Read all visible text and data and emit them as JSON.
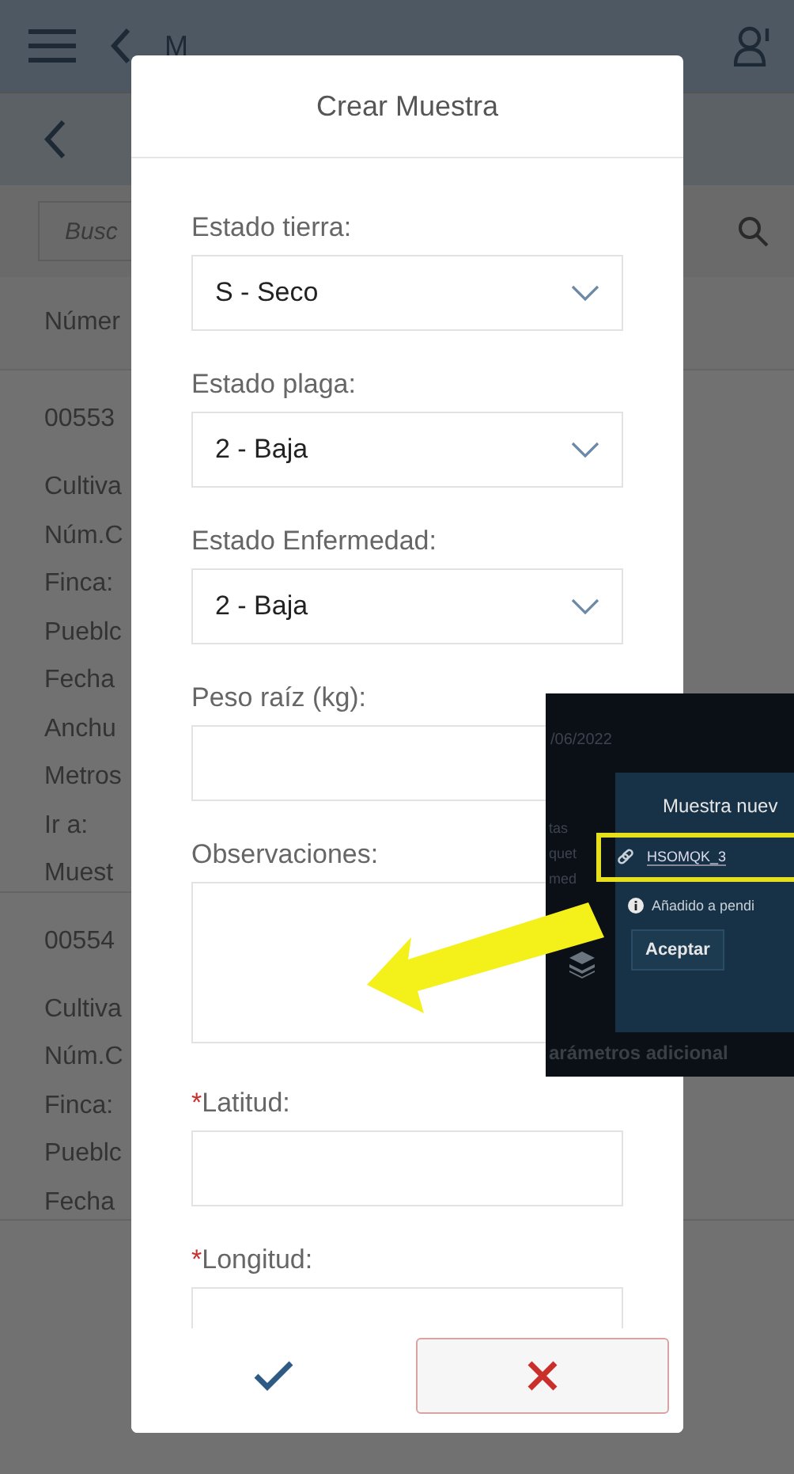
{
  "app_bar": {
    "title": "M"
  },
  "search": {
    "placeholder": "Busc"
  },
  "list_header": "Númer",
  "records": [
    {
      "id": "00553",
      "fields": [
        "Cultiva",
        "Núm.C",
        "Finca:",
        "Pueblc",
        "Fecha",
        "Anchu",
        "Metros",
        "Ir a:",
        "Muest"
      ]
    },
    {
      "id": "00554",
      "fields": [
        "Cultiva",
        "Núm.C",
        "Finca:",
        "Pueblc",
        "Fecha"
      ]
    }
  ],
  "dialog": {
    "title": "Crear Muestra",
    "fields": [
      {
        "kind": "select",
        "label": "Estado tierra:",
        "value": "S - Seco"
      },
      {
        "kind": "select",
        "label": "Estado plaga:",
        "value": "2 - Baja"
      },
      {
        "kind": "select",
        "label": "Estado Enfermedad:",
        "value": "2 - Baja"
      },
      {
        "kind": "input",
        "label": "Peso raíz (kg):"
      },
      {
        "kind": "textarea",
        "label": "Observaciones:"
      },
      {
        "kind": "input",
        "label": "Latitud:",
        "required_mark": "*"
      },
      {
        "kind": "input",
        "label": "Longitud:",
        "required_mark": "*"
      }
    ]
  },
  "inset": {
    "date": "/06/2022",
    "side_texts": [
      "tas",
      "quet",
      "med"
    ],
    "popup_title": "Muestra nuev",
    "code": "HSOMQK_3",
    "notice": "Añadido a pendi",
    "accept": "Aceptar",
    "footer": "arámetros adicional"
  }
}
